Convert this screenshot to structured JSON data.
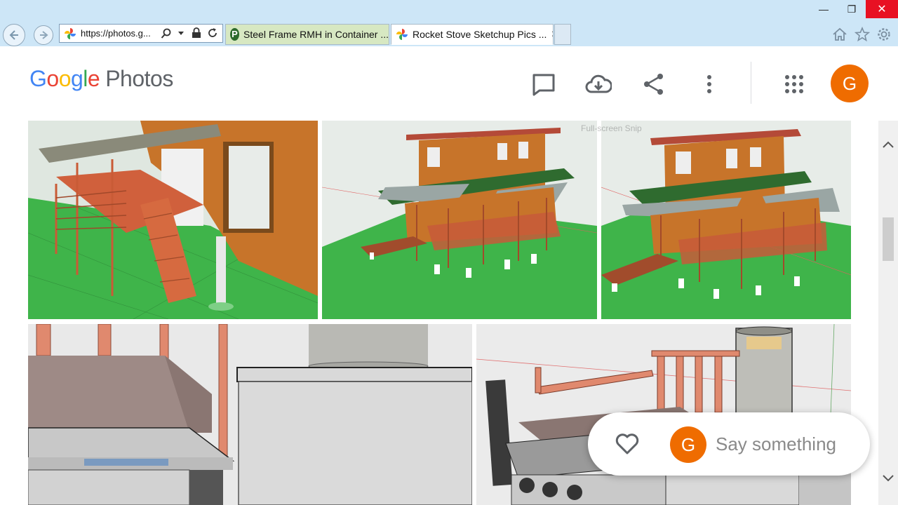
{
  "browser": {
    "address_text": "https://photos.g...",
    "tabs": [
      {
        "label": "Steel Frame RMH in Container ...",
        "active": false
      },
      {
        "label": "Rocket Stove Sketchup Pics ...",
        "active": true
      }
    ],
    "tab_close_glyph": "✕",
    "window_controls": {
      "minimize": "—",
      "maximize": "❐",
      "close": "✕"
    }
  },
  "header": {
    "logo_google": [
      "G",
      "o",
      "o",
      "g",
      "l",
      "e"
    ],
    "logo_colors": [
      "#4285f4",
      "#ea4335",
      "#fbbc05",
      "#4285f4",
      "#34a853",
      "#ea4335"
    ],
    "logo_photos": "Photos",
    "avatar_letter": "G",
    "icons": [
      "comment-icon",
      "cloud-download-icon",
      "share-icon",
      "more-vert-icon",
      "apps-grid-icon"
    ]
  },
  "content": {
    "snip_watermark": "Full-screen Snip"
  },
  "comment_bar": {
    "avatar_letter": "G",
    "placeholder": "Say something"
  },
  "colors": {
    "accent_avatar": "#ef6c00",
    "ie_chrome": "#cde6f7",
    "close_red": "#e81123"
  }
}
